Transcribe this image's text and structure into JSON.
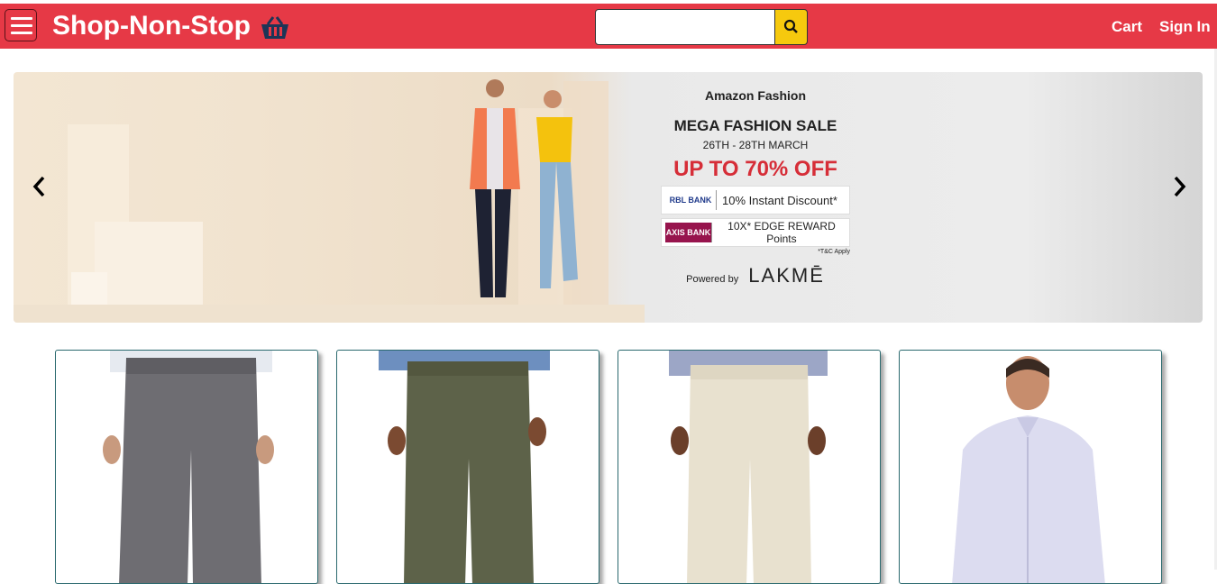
{
  "header": {
    "brand": "Shop-Non-Stop",
    "cart_label": "Cart",
    "signin_label": "Sign In",
    "menu_icon": "hamburger-icon",
    "basket_icon": "basket-icon",
    "search_icon": "search-icon",
    "search_value": "",
    "accent_color": "#e63946",
    "search_button_color": "#f6c90e"
  },
  "banner": {
    "brand": "Amazon Fashion",
    "headline": "MEGA FASHION SALE",
    "dates": "26TH - 28TH MARCH",
    "offer": "UP TO 70% OFF",
    "bank1_logo": "RBL BANK",
    "bank1_text": "10% Instant Discount*",
    "bank2_logo": "AXIS BANK",
    "bank2_text": "10X* EDGE REWARD Points",
    "tc": "*T&C Apply",
    "powered_label": "Powered by",
    "powered_brand": "LAKMĒ",
    "prev_icon": "chevron-left-icon",
    "next_icon": "chevron-right-icon"
  },
  "products": [
    {
      "image": "grey trousers"
    },
    {
      "image": "olive trousers"
    },
    {
      "image": "khaki trousers"
    },
    {
      "image": "lavender shirt"
    }
  ]
}
